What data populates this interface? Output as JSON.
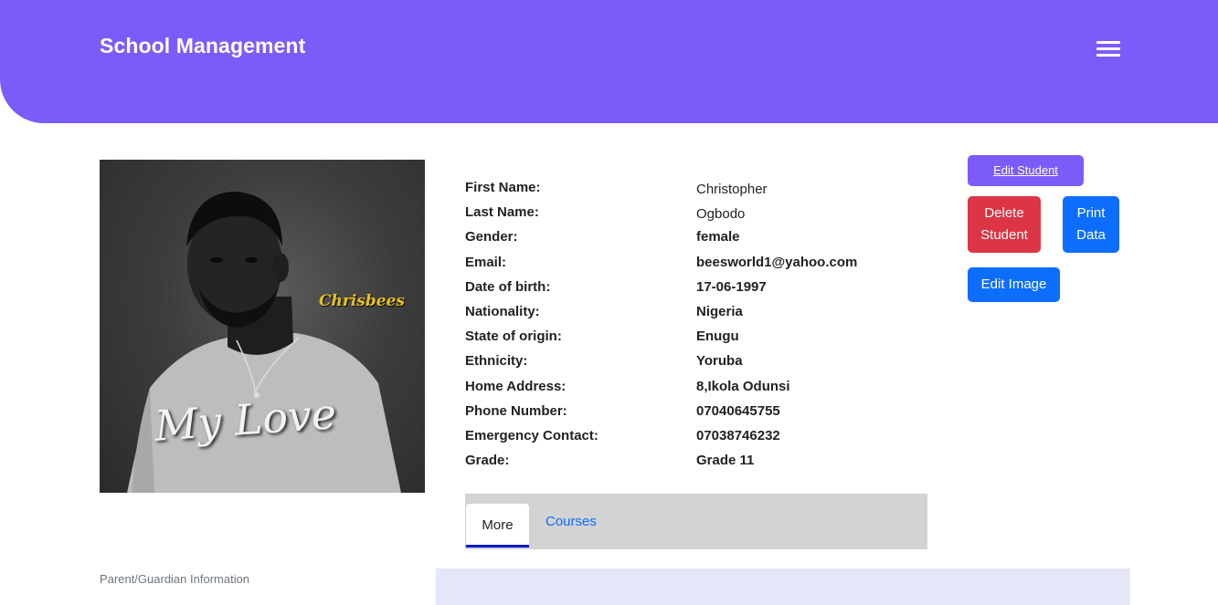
{
  "header": {
    "brand": "School Management",
    "menu_icon": "hamburger-icon"
  },
  "photo": {
    "signature_text": "Chrisbees",
    "shirt_text": "My Love"
  },
  "student": {
    "fields": [
      {
        "label": "First Name:",
        "value": "Christopher"
      },
      {
        "label": "Last Name:",
        "value": "Ogbodo"
      },
      {
        "label": "Gender:",
        "value": "female"
      },
      {
        "label": "Email:",
        "value": "beesworld1@yahoo.com"
      },
      {
        "label": "Date of birth:",
        "value": "17-06-1997"
      },
      {
        "label": "Nationality:",
        "value": "Nigeria"
      },
      {
        "label": "State of origin:",
        "value": "Enugu"
      },
      {
        "label": "Ethnicity:",
        "value": "Yoruba"
      },
      {
        "label": "Home Address:",
        "value": "8,Ikola Odunsi"
      },
      {
        "label": "Phone Number:",
        "value": "07040645755"
      },
      {
        "label": "Emergency Contact:",
        "value": "07038746232"
      },
      {
        "label": "Grade:",
        "value": "Grade 11"
      }
    ]
  },
  "actions": {
    "edit_student": "Edit Student",
    "delete_student": "Delete Student",
    "print_data": "Print Data",
    "edit_image": "Edit Image"
  },
  "tabs": {
    "more": "More",
    "courses": "Courses"
  },
  "parent_section": {
    "label": "Parent/Guardian Information"
  },
  "colors": {
    "header_bg": "#7b5cf8",
    "danger": "#dc3545",
    "primary": "#0d6efd",
    "tab_bar_bg": "#d3d3d3",
    "panel_bg": "#e6e6f9"
  }
}
